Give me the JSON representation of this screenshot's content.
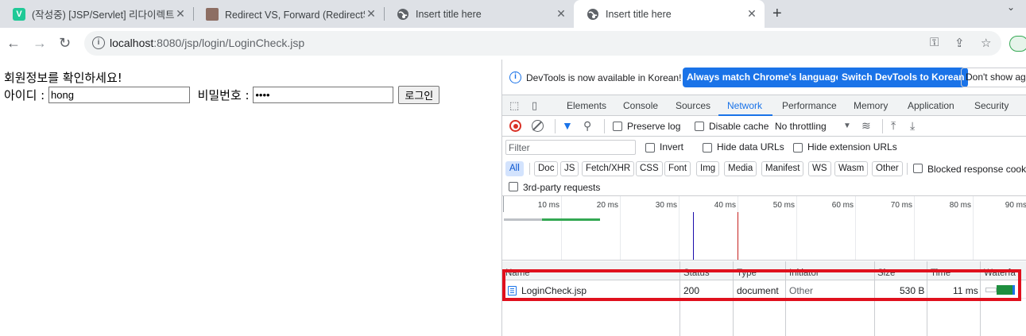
{
  "tabs": [
    {
      "title": "(작성중) [JSP/Servlet] 리다이렉트",
      "favicon": "velog-v-icon",
      "active": false
    },
    {
      "title": "Redirect VS, Forward (Redirect와",
      "favicon": "avatar-image-icon",
      "active": false
    },
    {
      "title": "Insert title here",
      "favicon": "globe-icon",
      "active": false
    },
    {
      "title": "Insert title here",
      "favicon": "globe-icon",
      "active": true
    }
  ],
  "address": {
    "host": "localhost",
    "path": ":8080/jsp/login/LoginCheck.jsp"
  },
  "page": {
    "heading": "회원정보를 확인하세요!",
    "id_label": "아이디 :",
    "id_value": "hong",
    "pw_label": "비밀번호 :",
    "pw_value": "••••",
    "login_button": "로그인"
  },
  "devtools": {
    "info_message": "DevTools is now available in Korean!",
    "btn_match": "Always match Chrome's language",
    "btn_switch": "Switch DevTools to Korean",
    "btn_dont": "Don't show ag",
    "panels": [
      "Elements",
      "Console",
      "Sources",
      "Network",
      "Performance",
      "Memory",
      "Application",
      "Security"
    ],
    "preserve_log": "Preserve log",
    "disable_cache": "Disable cache",
    "throttling": "No throttling",
    "filter_placeholder": "Filter",
    "invert": "Invert",
    "hide_data_urls": "Hide data URLs",
    "hide_ext_urls": "Hide extension URLs",
    "types": [
      "All",
      "Doc",
      "JS",
      "Fetch/XHR",
      "CSS",
      "Font",
      "Img",
      "Media",
      "Manifest",
      "WS",
      "Wasm",
      "Other"
    ],
    "blocked_cookies": "Blocked response cooki",
    "third_party": "3rd-party requests",
    "ticks": [
      "10 ms",
      "20 ms",
      "30 ms",
      "40 ms",
      "50 ms",
      "60 ms",
      "70 ms",
      "80 ms",
      "90 ms"
    ],
    "columns": [
      "Name",
      "Status",
      "Type",
      "Initiator",
      "Size",
      "Time",
      "Waterfa"
    ],
    "row": {
      "name": "LoginCheck.jsp",
      "status": "200",
      "type": "document",
      "initiator": "Other",
      "size": "530 B",
      "time": "11 ms"
    }
  },
  "colors": {
    "accent": "#1a73e8",
    "highlight": "#e0101d"
  }
}
